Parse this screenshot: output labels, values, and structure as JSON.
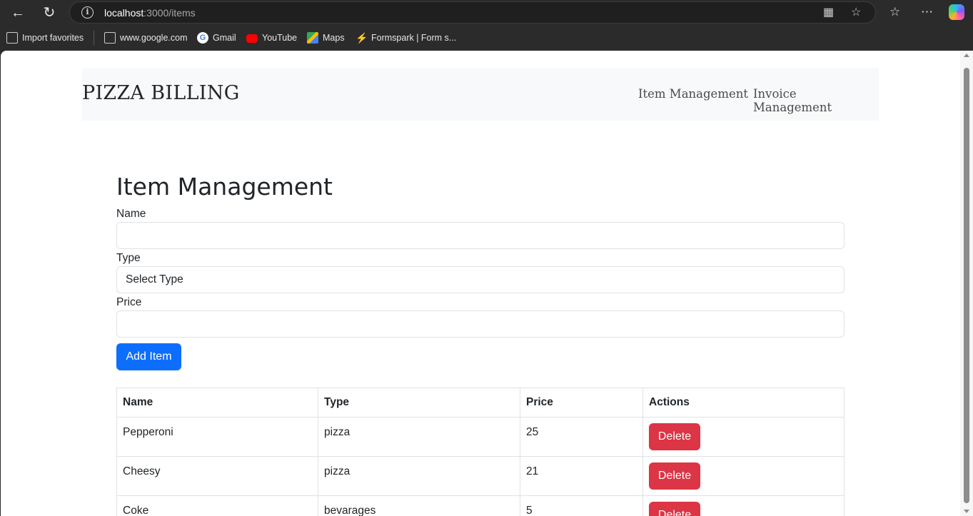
{
  "browser": {
    "url_host": "localhost",
    "url_path": ":3000/items",
    "bookmarks": [
      {
        "label": "Import favorites"
      },
      {
        "label": "www.google.com"
      },
      {
        "label": "Gmail"
      },
      {
        "label": "YouTube"
      },
      {
        "label": "Maps"
      },
      {
        "label": "Formspark | Form s..."
      }
    ]
  },
  "navbar": {
    "brand": "PIZZA BILLING",
    "links": [
      "Item Management",
      "Invoice Management"
    ]
  },
  "page": {
    "title": "Item Management",
    "form": {
      "name_label": "Name",
      "name_value": "",
      "type_label": "Type",
      "type_selected": "Select Type",
      "price_label": "Price",
      "price_value": "",
      "submit_label": "Add Item"
    },
    "table": {
      "headers": [
        "Name",
        "Type",
        "Price",
        "Actions"
      ],
      "rows": [
        {
          "name": "Pepperoni",
          "type": "pizza",
          "price": "25",
          "action": "Delete"
        },
        {
          "name": "Cheesy",
          "type": "pizza",
          "price": "21",
          "action": "Delete"
        },
        {
          "name": "Coke",
          "type": "bevarages",
          "price": "5",
          "action": "Delete"
        }
      ]
    }
  },
  "colors": {
    "primary": "#0d6efd",
    "danger": "#dc3545",
    "navbar_bg": "#f8f9fa"
  }
}
